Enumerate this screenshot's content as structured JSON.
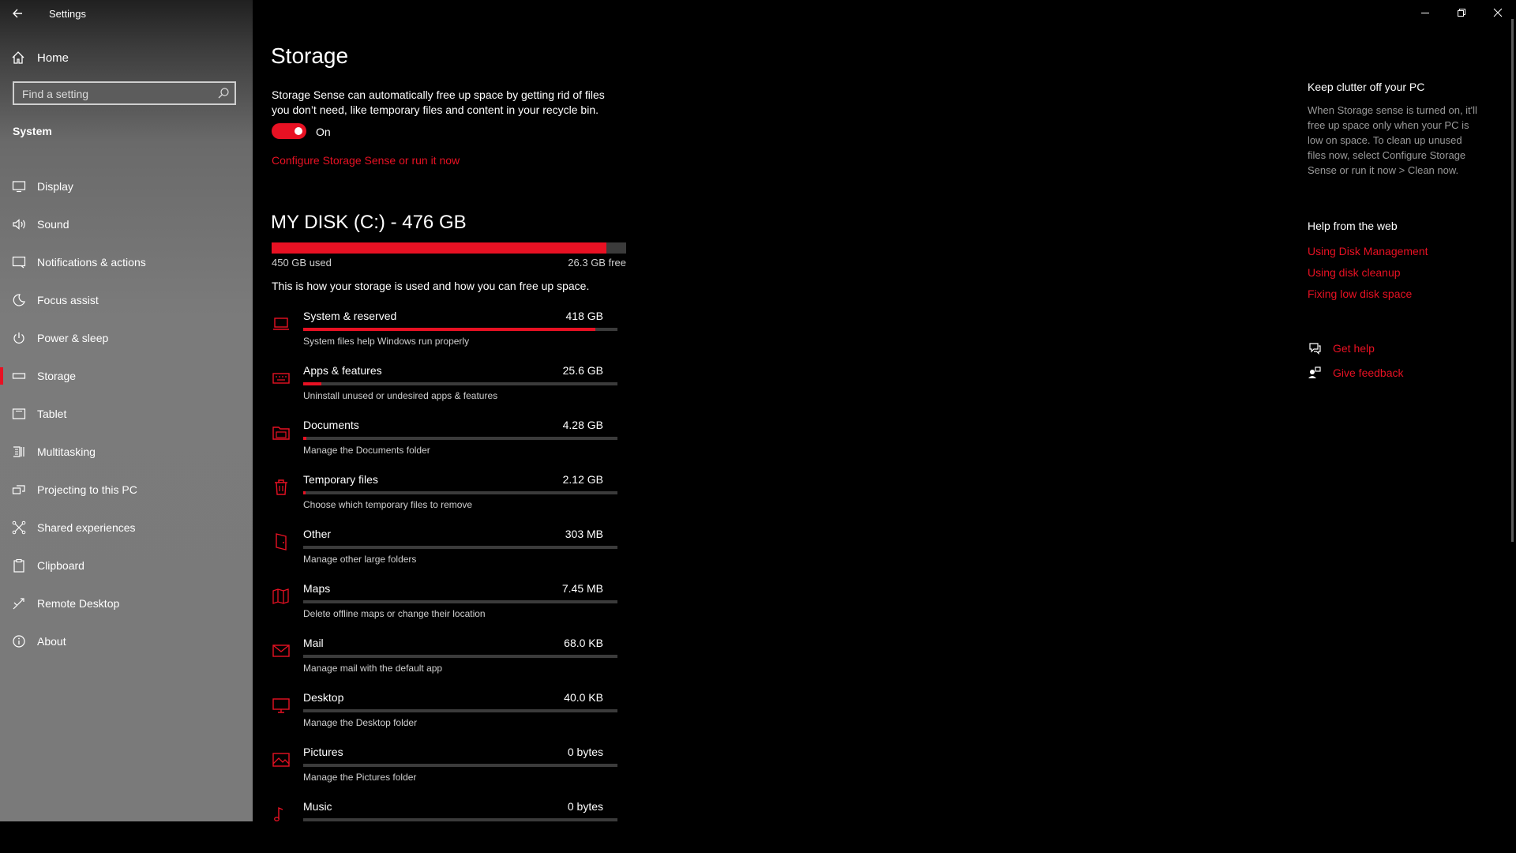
{
  "window": {
    "title": "Settings",
    "controls": [
      "minimize",
      "restore",
      "close"
    ]
  },
  "sidebar": {
    "home_label": "Home",
    "search_placeholder": "Find a setting",
    "section_label": "System",
    "items": [
      {
        "label": "Display",
        "icon": "display-icon"
      },
      {
        "label": "Sound",
        "icon": "speaker-icon"
      },
      {
        "label": "Notifications & actions",
        "icon": "notification-icon"
      },
      {
        "label": "Focus assist",
        "icon": "moon-icon"
      },
      {
        "label": "Power & sleep",
        "icon": "power-icon"
      },
      {
        "label": "Storage",
        "icon": "drive-icon",
        "active": true
      },
      {
        "label": "Tablet",
        "icon": "tablet-icon"
      },
      {
        "label": "Multitasking",
        "icon": "multitasking-icon"
      },
      {
        "label": "Projecting to this PC",
        "icon": "projecting-icon"
      },
      {
        "label": "Shared experiences",
        "icon": "shared-icon"
      },
      {
        "label": "Clipboard",
        "icon": "clipboard-icon"
      },
      {
        "label": "Remote Desktop",
        "icon": "remote-desktop-icon"
      },
      {
        "label": "About",
        "icon": "info-icon"
      }
    ]
  },
  "main": {
    "title": "Storage",
    "sense_description": "Storage Sense can automatically free up space by getting rid of files you don’t need, like temporary files and content in your recycle bin.",
    "toggle_state": "On",
    "configure_link": "Configure Storage Sense or run it now",
    "disk": {
      "title": "MY DISK (C:) - 476 GB",
      "used_label": "450 GB used",
      "free_label": "26.3 GB free",
      "used_fraction": 0.945
    },
    "usage_description": "This is how your storage is used and how you can free up space.",
    "categories": [
      {
        "name": "System & reserved",
        "size": "418 GB",
        "desc": "System files help Windows run properly",
        "fraction": 0.93,
        "icon": "laptop-icon"
      },
      {
        "name": "Apps & features",
        "size": "25.6 GB",
        "desc": "Uninstall unused or undesired apps & features",
        "fraction": 0.057,
        "icon": "keyboard-icon"
      },
      {
        "name": "Documents",
        "size": "4.28 GB",
        "desc": "Manage the Documents folder",
        "fraction": 0.01,
        "icon": "folder-icon"
      },
      {
        "name": "Temporary files",
        "size": "2.12 GB",
        "desc": "Choose which temporary files to remove",
        "fraction": 0.005,
        "icon": "trash-icon"
      },
      {
        "name": "Other",
        "size": "303 MB",
        "desc": "Manage other large folders",
        "fraction": 0.0,
        "icon": "door-icon"
      },
      {
        "name": "Maps",
        "size": "7.45 MB",
        "desc": "Delete offline maps or change their location",
        "fraction": 0.0,
        "icon": "map-icon"
      },
      {
        "name": "Mail",
        "size": "68.0 KB",
        "desc": "Manage mail with the default app",
        "fraction": 0.0,
        "icon": "mail-icon"
      },
      {
        "name": "Desktop",
        "size": "40.0 KB",
        "desc": "Manage the Desktop folder",
        "fraction": 0.0,
        "icon": "monitor-icon"
      },
      {
        "name": "Pictures",
        "size": "0 bytes",
        "desc": "Manage the Pictures folder",
        "fraction": 0.0,
        "icon": "picture-icon"
      },
      {
        "name": "Music",
        "size": "0 bytes",
        "desc": "",
        "fraction": 0.0,
        "icon": "music-icon"
      }
    ]
  },
  "right_panel": {
    "clutter_title": "Keep clutter off your PC",
    "clutter_text": "When Storage sense is turned on, it'll free up space only when your PC is low on space. To clean up unused files now, select Configure Storage Sense or run it now > Clean now.",
    "help_title": "Help from the web",
    "help_links": [
      "Using Disk Management",
      "Using disk cleanup",
      "Fixing low disk space"
    ],
    "get_help": "Get help",
    "give_feedback": "Give feedback"
  },
  "colors": {
    "accent": "#e81123",
    "background": "#000000",
    "bar_track": "#3b3b3b"
  }
}
